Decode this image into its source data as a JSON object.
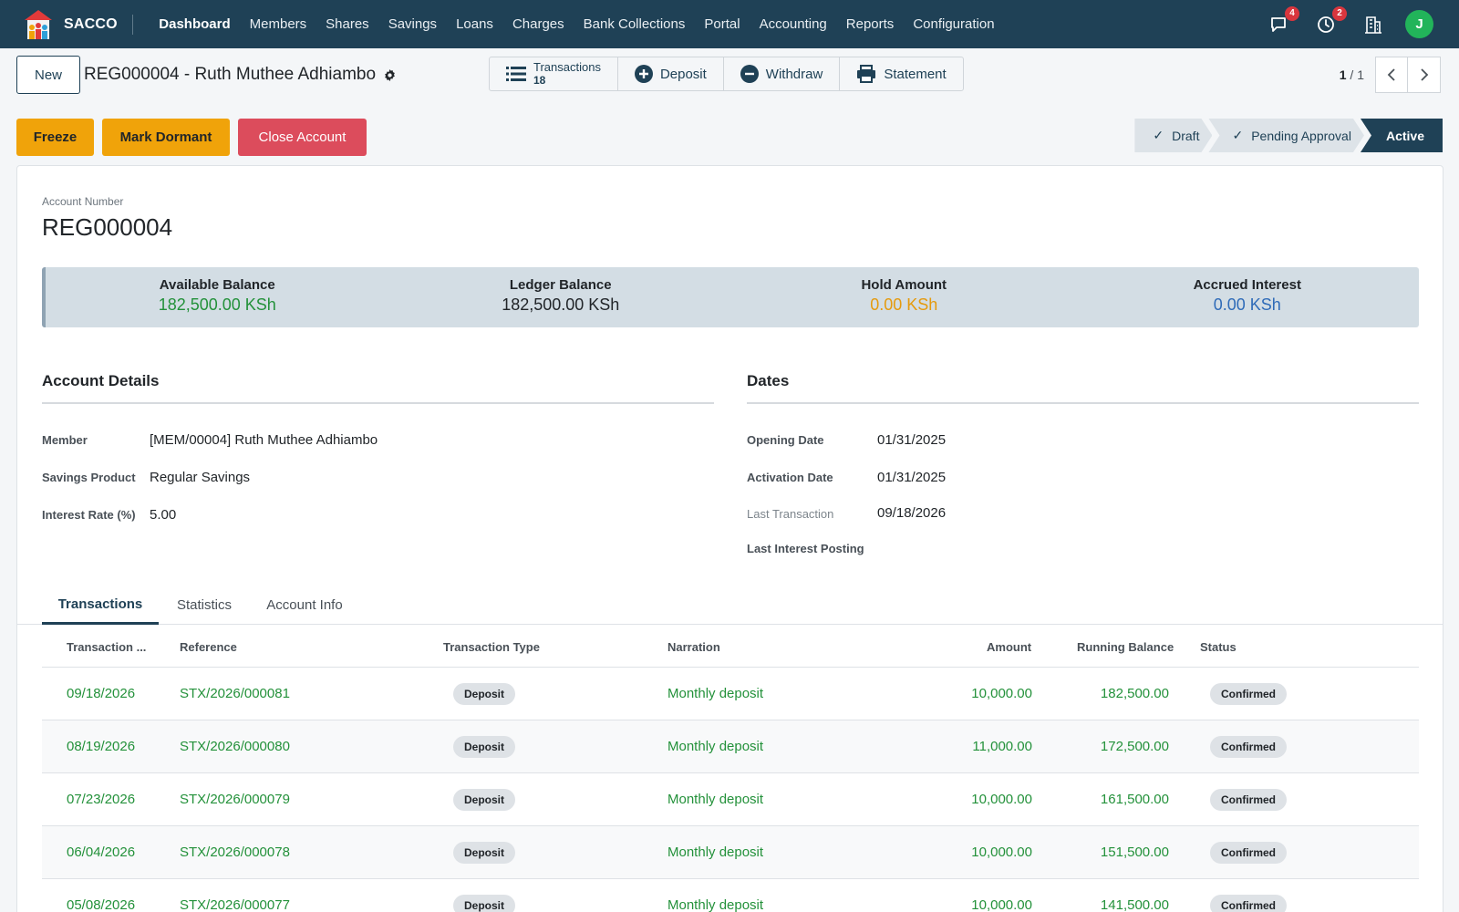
{
  "app": {
    "name": "SACCO",
    "user_initial": "J"
  },
  "nav": {
    "items": [
      "Dashboard",
      "Members",
      "Shares",
      "Savings",
      "Loans",
      "Charges",
      "Bank Collections",
      "Portal",
      "Accounting",
      "Reports",
      "Configuration"
    ],
    "active_index": 0,
    "messages_count": "4",
    "activities_count": "2"
  },
  "control": {
    "new_label": "New",
    "record_title": "REG000004 - Ruth Muthee Adhiambo",
    "smart_buttons": {
      "transactions_label": "Transactions",
      "transactions_count": "18",
      "deposit_label": "Deposit",
      "withdraw_label": "Withdraw",
      "statement_label": "Statement"
    },
    "pager": {
      "current": "1",
      "total": "/ 1"
    }
  },
  "actions": {
    "freeze": "Freeze",
    "mark_dormant": "Mark Dormant",
    "close_account": "Close Account"
  },
  "statusbar": {
    "stages": [
      {
        "label": "Draft",
        "done": true
      },
      {
        "label": "Pending Approval",
        "done": true
      },
      {
        "label": "Active",
        "done": false,
        "current": true
      }
    ],
    "check_glyph": "✓"
  },
  "account": {
    "number_label": "Account Number",
    "number": "REG000004"
  },
  "balances": {
    "available_label": "Available Balance",
    "available": "182,500.00 KSh",
    "ledger_label": "Ledger Balance",
    "ledger": "182,500.00 KSh",
    "hold_label": "Hold Amount",
    "hold": "0.00 KSh",
    "interest_label": "Accrued Interest",
    "interest": "0.00 KSh"
  },
  "details": {
    "title": "Account Details",
    "member_label": "Member",
    "member": "[MEM/00004] Ruth Muthee Adhiambo",
    "product_label": "Savings Product",
    "product": "Regular Savings",
    "rate_label": "Interest Rate (%)",
    "rate": "5.00"
  },
  "dates": {
    "title": "Dates",
    "opening_label": "Opening Date",
    "opening": "01/31/2025",
    "activation_label": "Activation Date",
    "activation": "01/31/2025",
    "last_tx_label": "Last Transaction",
    "last_tx": "09/18/2026",
    "last_interest_label": "Last Interest Posting",
    "last_interest": ""
  },
  "tabs": [
    "Transactions",
    "Statistics",
    "Account Info"
  ],
  "table": {
    "headers": [
      "Transaction ...",
      "Reference",
      "Transaction Type",
      "Narration",
      "Amount",
      "Running Balance",
      "Status"
    ],
    "rows": [
      {
        "date": "09/18/2026",
        "ref": "STX/2026/000081",
        "type": "Deposit",
        "narration": "Monthly deposit",
        "amount": "10,000.00",
        "balance": "182,500.00",
        "status": "Confirmed"
      },
      {
        "date": "08/19/2026",
        "ref": "STX/2026/000080",
        "type": "Deposit",
        "narration": "Monthly deposit",
        "amount": "11,000.00",
        "balance": "172,500.00",
        "status": "Confirmed"
      },
      {
        "date": "07/23/2026",
        "ref": "STX/2026/000079",
        "type": "Deposit",
        "narration": "Monthly deposit",
        "amount": "10,000.00",
        "balance": "161,500.00",
        "status": "Confirmed"
      },
      {
        "date": "06/04/2026",
        "ref": "STX/2026/000078",
        "type": "Deposit",
        "narration": "Monthly deposit",
        "amount": "10,000.00",
        "balance": "151,500.00",
        "status": "Confirmed"
      },
      {
        "date": "05/08/2026",
        "ref": "STX/2026/000077",
        "type": "Deposit",
        "narration": "Monthly deposit",
        "amount": "10,000.00",
        "balance": "141,500.00",
        "status": "Confirmed"
      }
    ]
  },
  "colors": {
    "navbar": "#1f4156",
    "accent_green": "#23913a",
    "warning": "#f0a30a",
    "danger": "#dc4c5c"
  }
}
